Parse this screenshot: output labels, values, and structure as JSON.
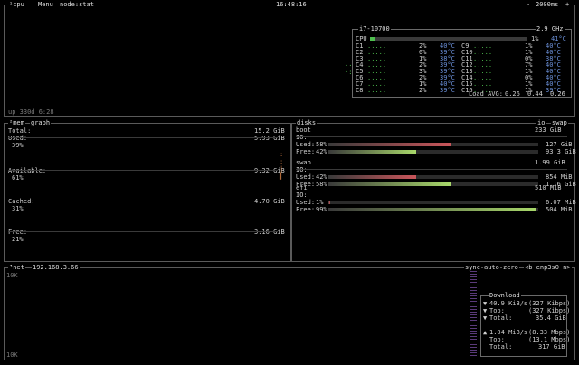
{
  "top": {
    "cpu_tab": "cpu",
    "menu_tab": "Menu",
    "preset_tab": "node:stat",
    "clock": "16:48:16",
    "interval": "2000ms",
    "interval_minus": "-",
    "interval_plus": "+"
  },
  "cpu": {
    "model": "i7-10700",
    "freq": "2.9 GHz",
    "uptime": "up 330d 6:28",
    "total_label": "CPU",
    "total_pct": "1%",
    "total_temp": "41°C",
    "load_label": "Load AVG:",
    "load": [
      "0.26",
      "0.44",
      "0.26"
    ],
    "cores_left": [
      {
        "name": "C1",
        "pct": "2%",
        "temp": "40°C"
      },
      {
        "name": "C2",
        "pct": "0%",
        "temp": "39°C"
      },
      {
        "name": "C3",
        "pct": "1%",
        "temp": "38°C"
      },
      {
        "name": "C4",
        "pct": "2%",
        "temp": "39°C"
      },
      {
        "name": "C5",
        "pct": "3%",
        "temp": "39°C"
      },
      {
        "name": "C6",
        "pct": "2%",
        "temp": "39°C"
      },
      {
        "name": "C7",
        "pct": "1%",
        "temp": "40°C"
      },
      {
        "name": "C8",
        "pct": "2%",
        "temp": "39°C"
      }
    ],
    "cores_right": [
      {
        "name": "C9",
        "pct": "1%",
        "temp": "40°C"
      },
      {
        "name": "C10",
        "pct": "1%",
        "temp": "40°C"
      },
      {
        "name": "C11",
        "pct": "0%",
        "temp": "38°C"
      },
      {
        "name": "C12",
        "pct": "7%",
        "temp": "40°C"
      },
      {
        "name": "C13",
        "pct": "1%",
        "temp": "40°C"
      },
      {
        "name": "C14",
        "pct": "0%",
        "temp": "40°C"
      },
      {
        "name": "C15",
        "pct": "1%",
        "temp": "40°C"
      },
      {
        "name": "C16",
        "pct": "1%",
        "temp": "39°C"
      }
    ],
    "total_fraction": 0.01
  },
  "mem": {
    "mem_tab": "mem",
    "graph_tab": "graph",
    "total_label": "Total:",
    "total": "15.2 GiB",
    "used_label": "Used:",
    "used": "5.93 GiB",
    "used_pct": "39%",
    "avail_label": "Available:",
    "avail": "9.32 GiB",
    "avail_pct": "61%",
    "cached_label": "Cached:",
    "cached": "4.70 GiB",
    "cached_pct": "31%",
    "free_label": "Free:",
    "free": "3.16 GiB",
    "free_pct": "21%"
  },
  "disks": {
    "title": "disks",
    "io_tab": "io",
    "swap_tab": "swap",
    "items": [
      {
        "name": "boot",
        "size": "233 GiB",
        "io": "IO:",
        "used_label": "Used:",
        "used_pct": "58%",
        "used_frac": 0.58,
        "used": "127 GiB",
        "free_label": "Free:",
        "free_pct": "42%",
        "free_frac": 0.42,
        "free": "93.3 GiB"
      },
      {
        "name": "swap",
        "size": "1.99 GiB",
        "io": "IO:",
        "used_label": "Used:",
        "used_pct": "42%",
        "used_frac": 0.42,
        "used": "854 MiB",
        "free_label": "Free:",
        "free_pct": "58%",
        "free_frac": 0.58,
        "free": "1.16 GiB"
      },
      {
        "name": "efi",
        "size": "510 MiB",
        "io": "IO:",
        "used_label": "Used:",
        "used_pct": "1%",
        "used_frac": 0.01,
        "used": "6.07 MiB",
        "free_label": "Free:",
        "free_pct": "99%",
        "free_frac": 0.99,
        "free": "504 MiB"
      }
    ]
  },
  "net": {
    "net_tab": "net",
    "ip": "192.168.3.66",
    "sync_tab": "sync",
    "auto_tab": "auto",
    "zero_tab": "zero",
    "iface_tab": "<b enp3s0 n>",
    "scale_top": "10K",
    "scale_bottom": "10K",
    "download_title": "Download",
    "dl_rate": "40.9 KiB/s",
    "dl_bits": "(327 Kibps)",
    "dl_top_label": "Top:",
    "dl_top": "(327 Kibps)",
    "dl_total_label": "Total:",
    "dl_total": "35.4 GiB",
    "ul_rate": "1.04 MiB/s",
    "ul_bits": "(8.33 Mbps)",
    "ul_top_label": "Top:",
    "ul_top": "(13.1 Mbps)",
    "ul_total_label": "Total:",
    "ul_total": "317 GiB"
  },
  "colors": {
    "border": "#5a5a5a",
    "used_bar": "#c9555a",
    "free_bar": "#a8d86a",
    "cpu_bar": "#4fbf4f",
    "net_graph": "#8a5aa8"
  }
}
